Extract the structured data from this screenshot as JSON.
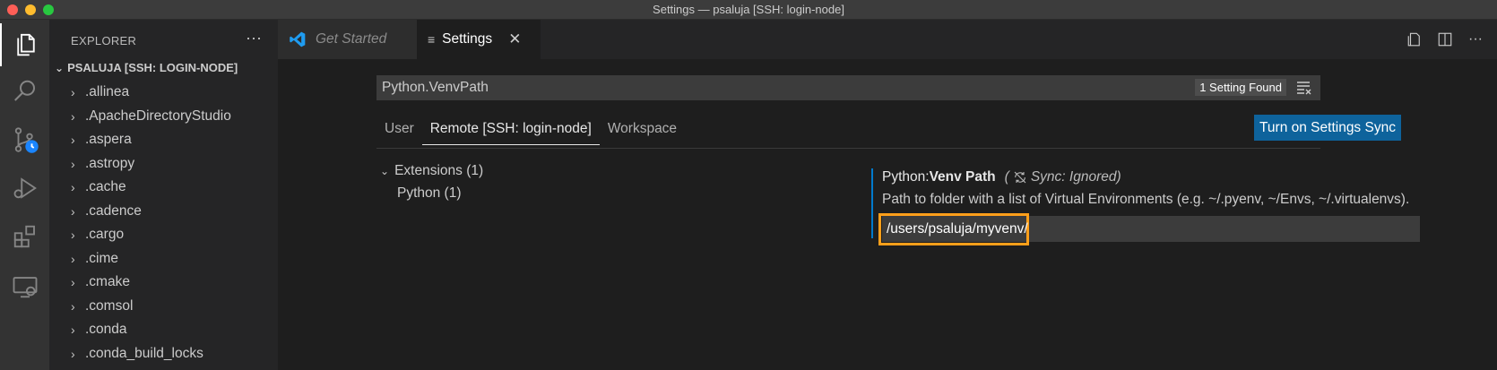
{
  "window": {
    "title": "Settings — psaluja [SSH: login-node]",
    "traffic_colors": [
      "#ff5f57",
      "#febc2e",
      "#28c840"
    ]
  },
  "sidebar": {
    "header": "EXPLORER",
    "more": "···",
    "root_label": "PSALUJA [SSH: LOGIN-NODE]",
    "items": [
      ".allinea",
      ".ApacheDirectoryStudio",
      ".aspera",
      ".astropy",
      ".cache",
      ".cadence",
      ".cargo",
      ".cime",
      ".cmake",
      ".comsol",
      ".conda",
      ".conda_build_locks"
    ]
  },
  "tabs": [
    {
      "label": "Get Started"
    },
    {
      "label": "Settings"
    }
  ],
  "settings": {
    "search_value": "Python.VenvPath",
    "found_badge": "1 Setting Found",
    "scopes": [
      "User",
      "Remote [SSH: login-node]",
      "Workspace"
    ],
    "sync_button": "Turn on Settings Sync",
    "toc": [
      {
        "label": "Extensions (1)"
      },
      {
        "label": "Python (1)"
      }
    ],
    "setting": {
      "category": "Python: ",
      "name": "Venv Path",
      "sync_note": "Sync: Ignored)",
      "sync_note_prefix": "(",
      "description": "Path to folder with a list of Virtual Environments (e.g. ~/.pyenv, ~/Envs, ~/.virtualenvs).",
      "value": "/users/psaluja/myvenv/"
    }
  },
  "colors": {
    "accent": "#007acc",
    "highlight": "#ff9f1a",
    "button": "#0e639c"
  }
}
